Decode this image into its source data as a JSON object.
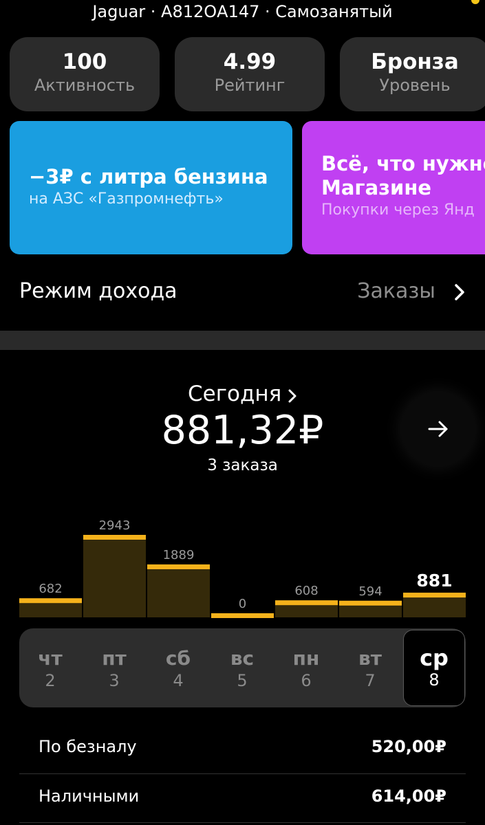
{
  "header": {
    "car_info": "Jaguar · А812ОА147 · Самозанятый"
  },
  "stats": [
    {
      "value": "100",
      "label": "Активность"
    },
    {
      "value": "4.99",
      "label": "Рейтинг"
    },
    {
      "value": "Бронза",
      "label": "Уровень"
    }
  ],
  "promos": [
    {
      "title": "−3₽ с литра бензина",
      "subtitle": "на АЗС «Газпромнефть»",
      "color": "#1a9ee0"
    },
    {
      "title_line1": "Всё, что нужно",
      "title_line2": "Магазине",
      "subtitle": "Покупки через Янд",
      "color": "#c040f2"
    }
  ],
  "income_mode": {
    "label": "Режим дохода",
    "value": "Заказы"
  },
  "today": {
    "label": "Сегодня",
    "amount": "881,32₽",
    "orders": "3 заказа"
  },
  "chart_data": {
    "type": "bar",
    "categories": [
      "чт",
      "пт",
      "сб",
      "вс",
      "пн",
      "вт",
      "ср"
    ],
    "values": [
      682,
      2943,
      1889,
      0,
      608,
      594,
      881
    ],
    "value_labels": [
      "682",
      "2943",
      "1889",
      "0",
      "608",
      "594",
      "881"
    ],
    "selected_index": 6,
    "bar_color": "#352a0a",
    "cap_color": "#f5b21b"
  },
  "days": [
    {
      "name": "чт",
      "num": "2"
    },
    {
      "name": "пт",
      "num": "3"
    },
    {
      "name": "сб",
      "num": "4"
    },
    {
      "name": "вс",
      "num": "5"
    },
    {
      "name": "пн",
      "num": "6"
    },
    {
      "name": "вт",
      "num": "7"
    },
    {
      "name": "ср",
      "num": "8"
    }
  ],
  "payments": [
    {
      "label": "По безналу",
      "value": "520,00₽"
    },
    {
      "label": "Наличными",
      "value": "614,00₽"
    }
  ]
}
